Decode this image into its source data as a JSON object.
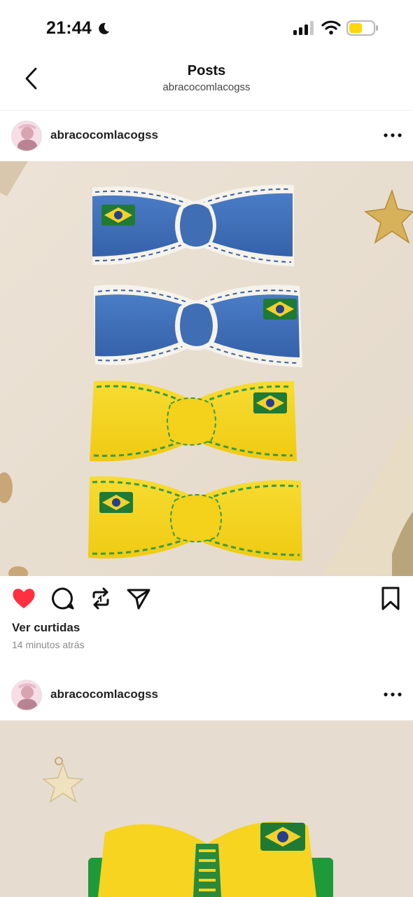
{
  "status_bar": {
    "time": "21:44"
  },
  "header": {
    "title": "Posts",
    "subtitle": "abracocomlacogss"
  },
  "posts": [
    {
      "username": "abracocomlacogss",
      "likes_label": "Ver curtidas",
      "time_ago": "14 minutos atrás",
      "liked": true
    },
    {
      "username": "abracocomlacogss"
    }
  ],
  "colors": {
    "like_red": "#ff3040",
    "ribbon_blue": "#3d6fb8",
    "ribbon_yellow": "#f4d320",
    "flag_green": "#1f7a35",
    "battery_yellow": "#ffd60a"
  },
  "icons": [
    "moon-icon",
    "signal-icon",
    "wifi-icon",
    "battery-icon",
    "back-arrow-icon",
    "more-options-icon",
    "heart-icon",
    "comment-icon",
    "repost-icon",
    "share-icon",
    "bookmark-icon"
  ]
}
